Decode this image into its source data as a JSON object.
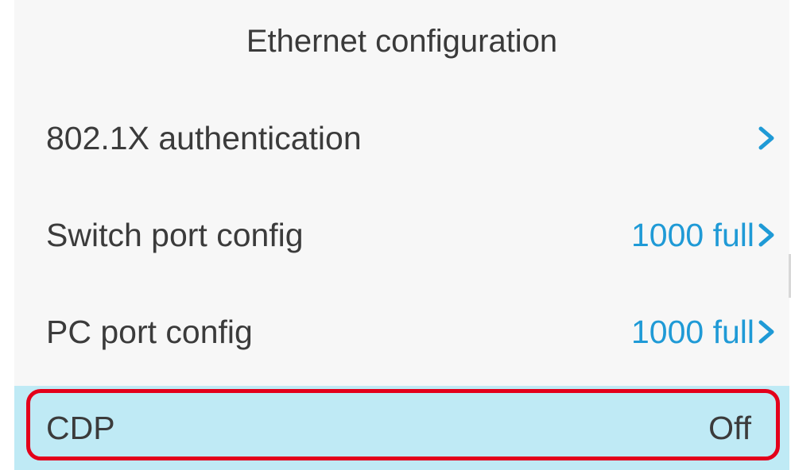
{
  "header": {
    "title": "Ethernet configuration"
  },
  "rows": [
    {
      "label": "802.1X authentication",
      "value": "",
      "icon": "chevron-right-icon"
    },
    {
      "label": "Switch port config",
      "value": "1000 full",
      "icon": "chevron-right-icon"
    },
    {
      "label": "PC port config",
      "value": "1000 full",
      "icon": "chevron-right-icon"
    },
    {
      "label": "CDP",
      "value": "Off",
      "selected": true
    }
  ],
  "colors": {
    "accent": "#1f9ad6",
    "selected_background": "#bfeaf5",
    "highlight_border": "#e3001b",
    "text": "#3b3b3b"
  }
}
